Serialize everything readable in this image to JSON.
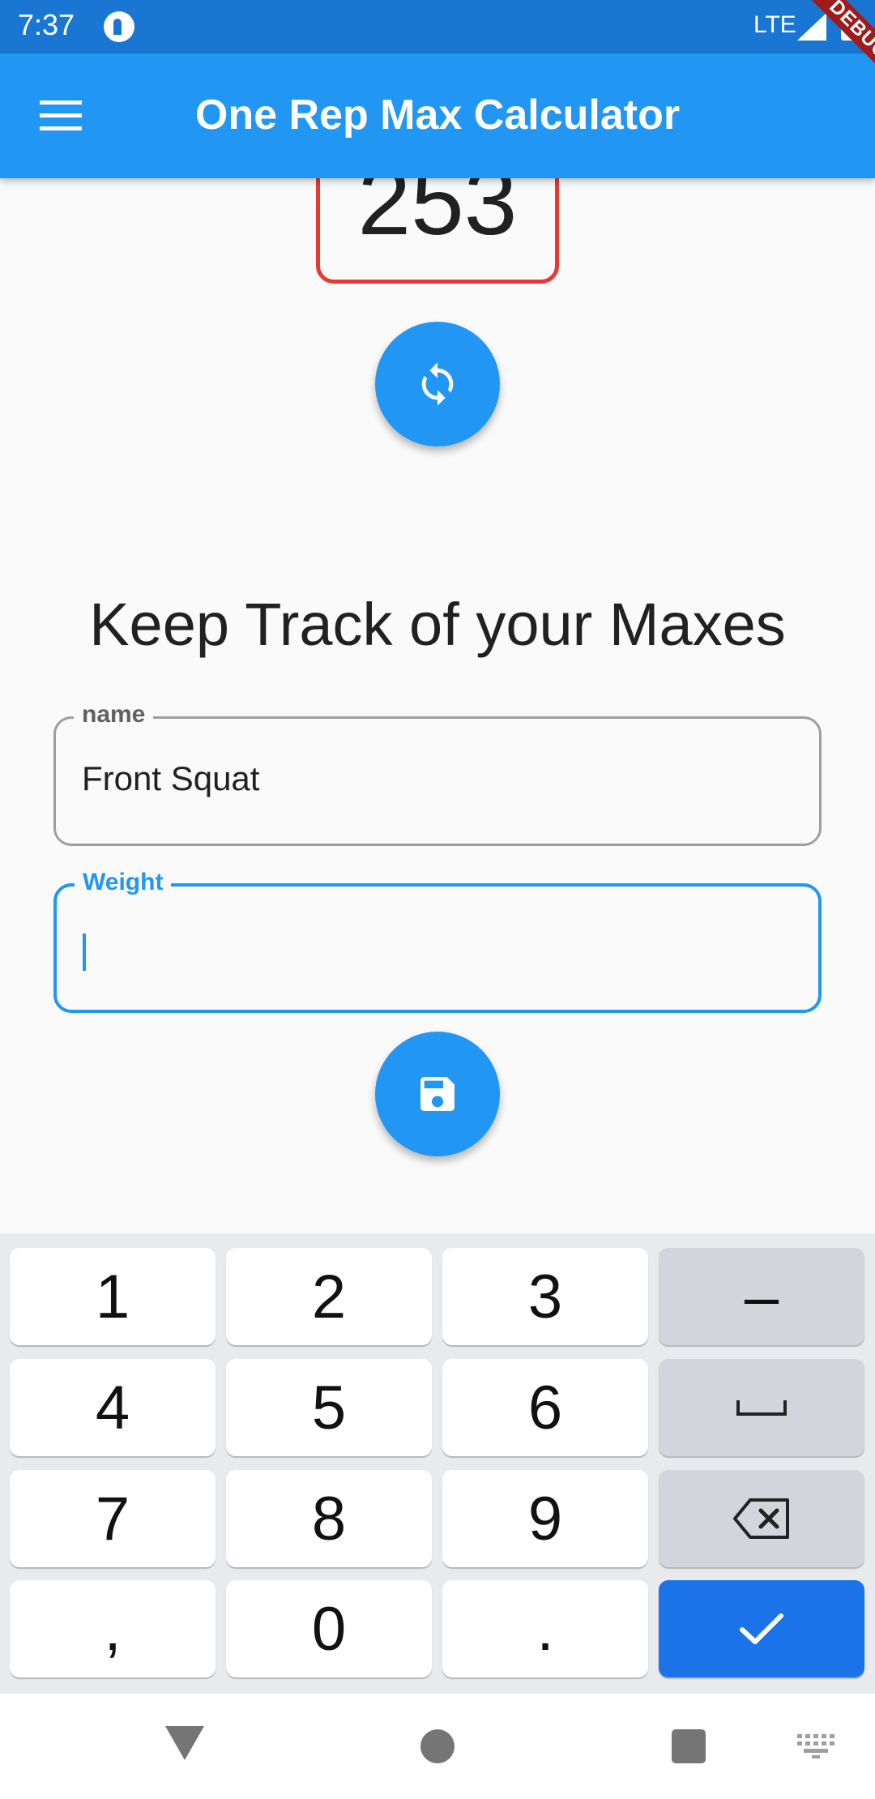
{
  "status_bar": {
    "time": "7:37",
    "network": "LTE",
    "icons": [
      "app-notification-icon",
      "signal-icon",
      "battery-icon"
    ]
  },
  "app_bar": {
    "title": "One Rep Max Calculator",
    "menu_icon": "menu-icon",
    "background": "#2196f3"
  },
  "debug_banner": "DEBUG",
  "result": {
    "value": "253",
    "border_color": "#e53935"
  },
  "refresh_fab": {
    "icon": "refresh-icon"
  },
  "tracker": {
    "heading": "Keep Track of your Maxes",
    "name_field": {
      "label": "name",
      "value": "Front Squat"
    },
    "weight_field": {
      "label": "Weight",
      "value": "",
      "focused": true
    },
    "save_fab": {
      "icon": "save-icon"
    }
  },
  "keyboard": {
    "keys": [
      [
        "1",
        "2",
        "3",
        "–"
      ],
      [
        "4",
        "5",
        "6",
        "space"
      ],
      [
        "7",
        "8",
        "9",
        "backspace"
      ],
      [
        ",",
        "0",
        ".",
        "done"
      ]
    ],
    "labels": {
      "k1": "1",
      "k2": "2",
      "k3": "3",
      "minus": "–",
      "k4": "4",
      "k5": "5",
      "k6": "6",
      "k7": "7",
      "k8": "8",
      "k9": "9",
      "comma": ",",
      "k0": "0",
      "period": "."
    },
    "done_color": "#1a73e8"
  },
  "nav_bar": {
    "icons": [
      "back-icon",
      "home-icon",
      "recents-icon",
      "keyboard-switch-icon"
    ]
  }
}
